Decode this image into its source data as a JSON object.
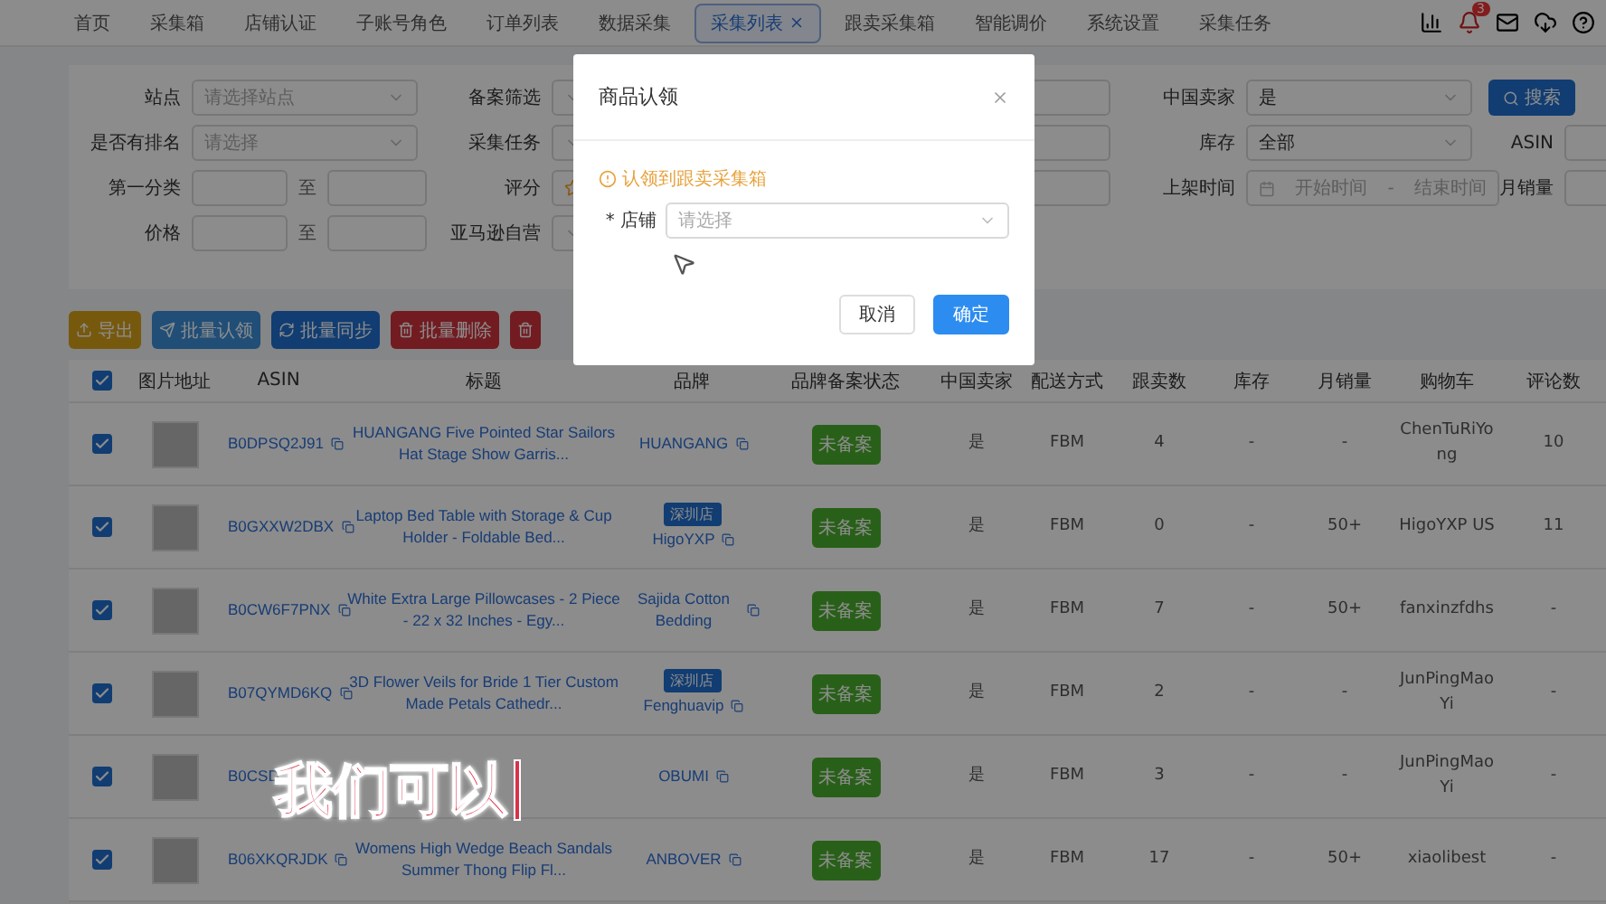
{
  "nav": {
    "tabs": [
      {
        "label": "首页",
        "selected": false,
        "closable": false
      },
      {
        "label": "采集箱",
        "selected": false,
        "closable": false
      },
      {
        "label": "店铺认证",
        "selected": false,
        "closable": false
      },
      {
        "label": "子账号角色",
        "selected": false,
        "closable": false
      },
      {
        "label": "订单列表",
        "selected": false,
        "closable": false
      },
      {
        "label": "数据采集",
        "selected": false,
        "closable": false
      },
      {
        "label": "采集列表",
        "selected": true,
        "closable": true
      },
      {
        "label": "跟卖采集箱",
        "selected": false,
        "closable": false
      },
      {
        "label": "智能调价",
        "selected": false,
        "closable": false
      },
      {
        "label": "系统设置",
        "selected": false,
        "closable": false
      },
      {
        "label": "采集任务",
        "selected": false,
        "closable": false
      }
    ],
    "notification_count": "3"
  },
  "filters": [
    [
      {
        "kind": "select",
        "label": "站点",
        "placeholder": "请选择站点"
      },
      {
        "kind": "select",
        "label": "备案筛选"
      },
      {
        "kind": "select"
      },
      {
        "kind": "select",
        "label": "中国卖家",
        "value": "是"
      },
      {
        "kind": "button",
        "label": "搜索"
      }
    ],
    [
      {
        "kind": "select",
        "label": "是否有排名",
        "placeholder": "请选择"
      },
      {
        "kind": "select",
        "label": "采集任务"
      },
      {
        "kind": "select"
      },
      {
        "kind": "select",
        "label": "库存",
        "value": "全部"
      },
      {
        "kind": "text",
        "label": "ASIN"
      }
    ],
    [
      {
        "kind": "range",
        "label": "第一分类",
        "separator": "至"
      },
      {
        "kind": "rating",
        "label": "评分"
      },
      {
        "kind": "select"
      },
      {
        "kind": "date",
        "label": "上架时间",
        "start": "开始时间",
        "separator": "-",
        "end": "结束时间"
      },
      {
        "kind": "text",
        "label": "月销量"
      }
    ],
    [
      {
        "kind": "range",
        "label": "价格",
        "separator": "至"
      },
      {
        "kind": "select",
        "label": "亚马逊自营"
      }
    ]
  ],
  "actions": [
    {
      "label": "导出",
      "kind": "export"
    },
    {
      "label": "批量认领",
      "kind": "claim"
    },
    {
      "label": "批量同步",
      "kind": "sync"
    },
    {
      "label": "批量删除",
      "kind": "delete"
    },
    {
      "kind": "delete"
    }
  ],
  "table": {
    "all_checked": true,
    "columns": [
      "图片地址",
      "ASIN",
      "标题",
      "品牌",
      "品牌备案状态",
      "中国卖家",
      "配送方式",
      "跟卖数",
      "库存",
      "月销量",
      "购物车",
      "评论数"
    ],
    "rows": [
      {
        "checked": true,
        "asin": "B0DPSQ2J91",
        "asin_copy": true,
        "title": "HUANGANG Five Pointed Star Sailors Hat Stage Show Garris...",
        "brand": "HUANGANG",
        "status": "未备案",
        "cn_seller": "是",
        "shipping": "FBM",
        "sellers": "4",
        "stock": "-",
        "monthly": "-",
        "buybox": "ChenTuRiYong",
        "reviews": "10"
      },
      {
        "checked": true,
        "asin": "B0GXXW2DBX",
        "asin_copy": true,
        "title": "Laptop Bed Table with Storage & Cup Holder - Foldable Bed...",
        "brand_tag": "深圳店",
        "brand": "HigoYXP",
        "status": "未备案",
        "cn_seller": "是",
        "shipping": "FBM",
        "sellers": "0",
        "stock": "-",
        "monthly": "50+",
        "buybox": "HigoYXP US",
        "reviews": "11"
      },
      {
        "checked": true,
        "asin": "B0CW6F7PNX",
        "asin_copy": true,
        "title": "White Extra Large Pillowcases - 2 Piece - 22 x 32 Inches - Egy...",
        "brand": "Sajida Cotton Bedding",
        "status": "未备案",
        "cn_seller": "是",
        "shipping": "FBM",
        "sellers": "7",
        "stock": "-",
        "monthly": "50+",
        "buybox": "fanxinzfdhs",
        "reviews": "-"
      },
      {
        "checked": true,
        "asin": "B07QYMD6KQ",
        "asin_copy": true,
        "title": "3D Flower Veils for Bride 1 Tier Custom Made Petals Cathedr...",
        "brand_tag": "深圳店",
        "brand": "Fenghuavip",
        "status": "未备案",
        "cn_seller": "是",
        "shipping": "FBM",
        "sellers": "2",
        "stock": "-",
        "monthly": "-",
        "buybox": "JunPingMaoYi",
        "reviews": "-"
      },
      {
        "checked": true,
        "asin": "B0CSD",
        "asin_copy": false,
        "brand": "OBUMI",
        "status": "未备案",
        "cn_seller": "是",
        "shipping": "FBM",
        "sellers": "3",
        "stock": "-",
        "monthly": "-",
        "buybox": "JunPingMaoYi",
        "reviews": "-"
      },
      {
        "checked": true,
        "asin": "B06XKQRJDK",
        "asin_copy": true,
        "title": "Womens High Wedge Beach Sandals Summer Thong Flip Fl...",
        "brand": "ANBOVER",
        "status": "未备案",
        "cn_seller": "是",
        "shipping": "FBM",
        "sellers": "17",
        "stock": "-",
        "monthly": "50+",
        "buybox": "xiaolibest",
        "reviews": "-"
      }
    ]
  },
  "modal": {
    "title": "商品认领",
    "notice": "认领到跟卖采集箱",
    "field": {
      "label": "* 店铺",
      "placeholder": "请选择"
    },
    "buttons": [
      {
        "label": "取消",
        "primary": false
      },
      {
        "label": "确定",
        "primary": true
      }
    ]
  },
  "caption": "我们可以"
}
